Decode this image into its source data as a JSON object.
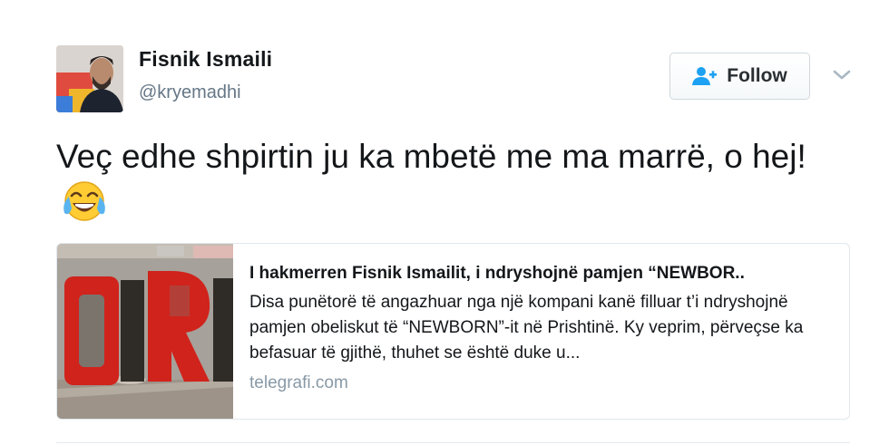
{
  "tweet": {
    "author": {
      "name": "Fisnik Ismaili",
      "handle": "@kryemadhi"
    },
    "follow_label": "Follow",
    "text": "Veç edhe shpirtin ju ka mbetë me ma marrë, o hej!",
    "emoji": "face-with-tears-of-joy"
  },
  "card": {
    "title": "I hakmerren Fisnik Ismailit, i ndryshojnë pamjen “NEWBOR..",
    "description": "Disa punëtorë të angazhuar nga një kompani kanë filluar t’i ndryshojnë pamjen obeliskut të “NEWBORN”-it në Prishtinë. Ky veprim, përveçse ka befasuar të gjithë, thuhet se është duke u...",
    "domain": "telegrafi.com"
  },
  "colors": {
    "text": "#14171a",
    "secondary": "#657786",
    "domain": "#8899a6",
    "follow_icon": "#1da1f2",
    "border": "#e1e8ed",
    "letters_red": "#d0231c"
  }
}
